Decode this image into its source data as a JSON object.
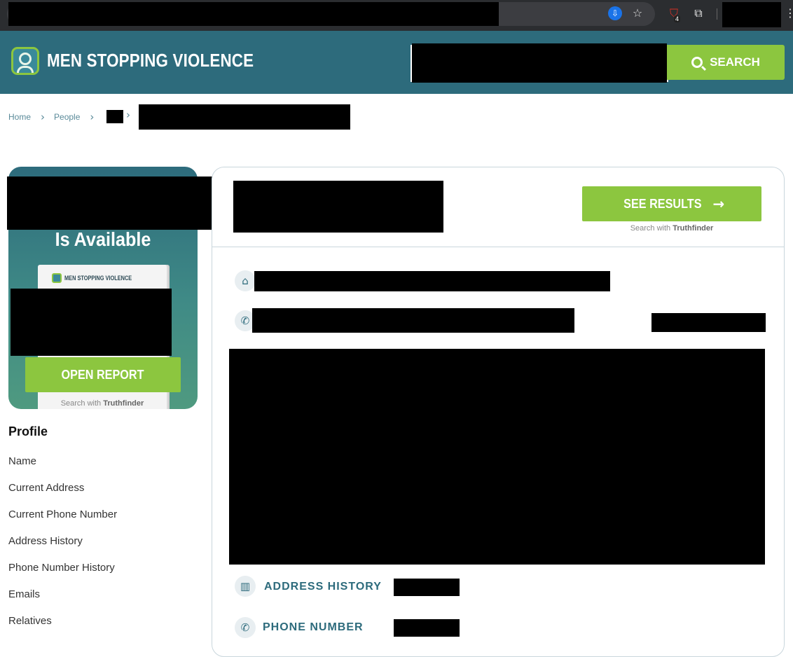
{
  "browser": {
    "icons": {
      "install": "install-app-icon",
      "star": "bookmark-star-icon",
      "extension": "shield-extension-icon",
      "puzzle": "extensions-puzzle-icon",
      "menu": "kebab-menu-icon"
    },
    "extension_badge": "4"
  },
  "header": {
    "logo_text": "MEN STOPPING VIOLENCE",
    "search_button": "SEARCH"
  },
  "breadcrumb": {
    "home": "Home",
    "people": "People"
  },
  "promo": {
    "available_text": "Is Available",
    "paper_logo_text": "MEN STOPPING VIOLENCE",
    "open_button": "OPEN REPORT",
    "search_with": "Search with",
    "brand": "Truthfinder"
  },
  "profile": {
    "heading": "Profile",
    "items": [
      "Name",
      "Current Address",
      "Current Phone Number",
      "Address History",
      "Phone Number History",
      "Emails",
      "Relatives"
    ]
  },
  "main": {
    "see_results": "SEE RESULTS",
    "search_with": "Search with",
    "brand": "Truthfinder",
    "address_history": "ADDRESS HISTORY",
    "phone_number": "PHONE NUMBER"
  },
  "colors": {
    "teal": "#2d6b7c",
    "green": "#8cc63f"
  }
}
